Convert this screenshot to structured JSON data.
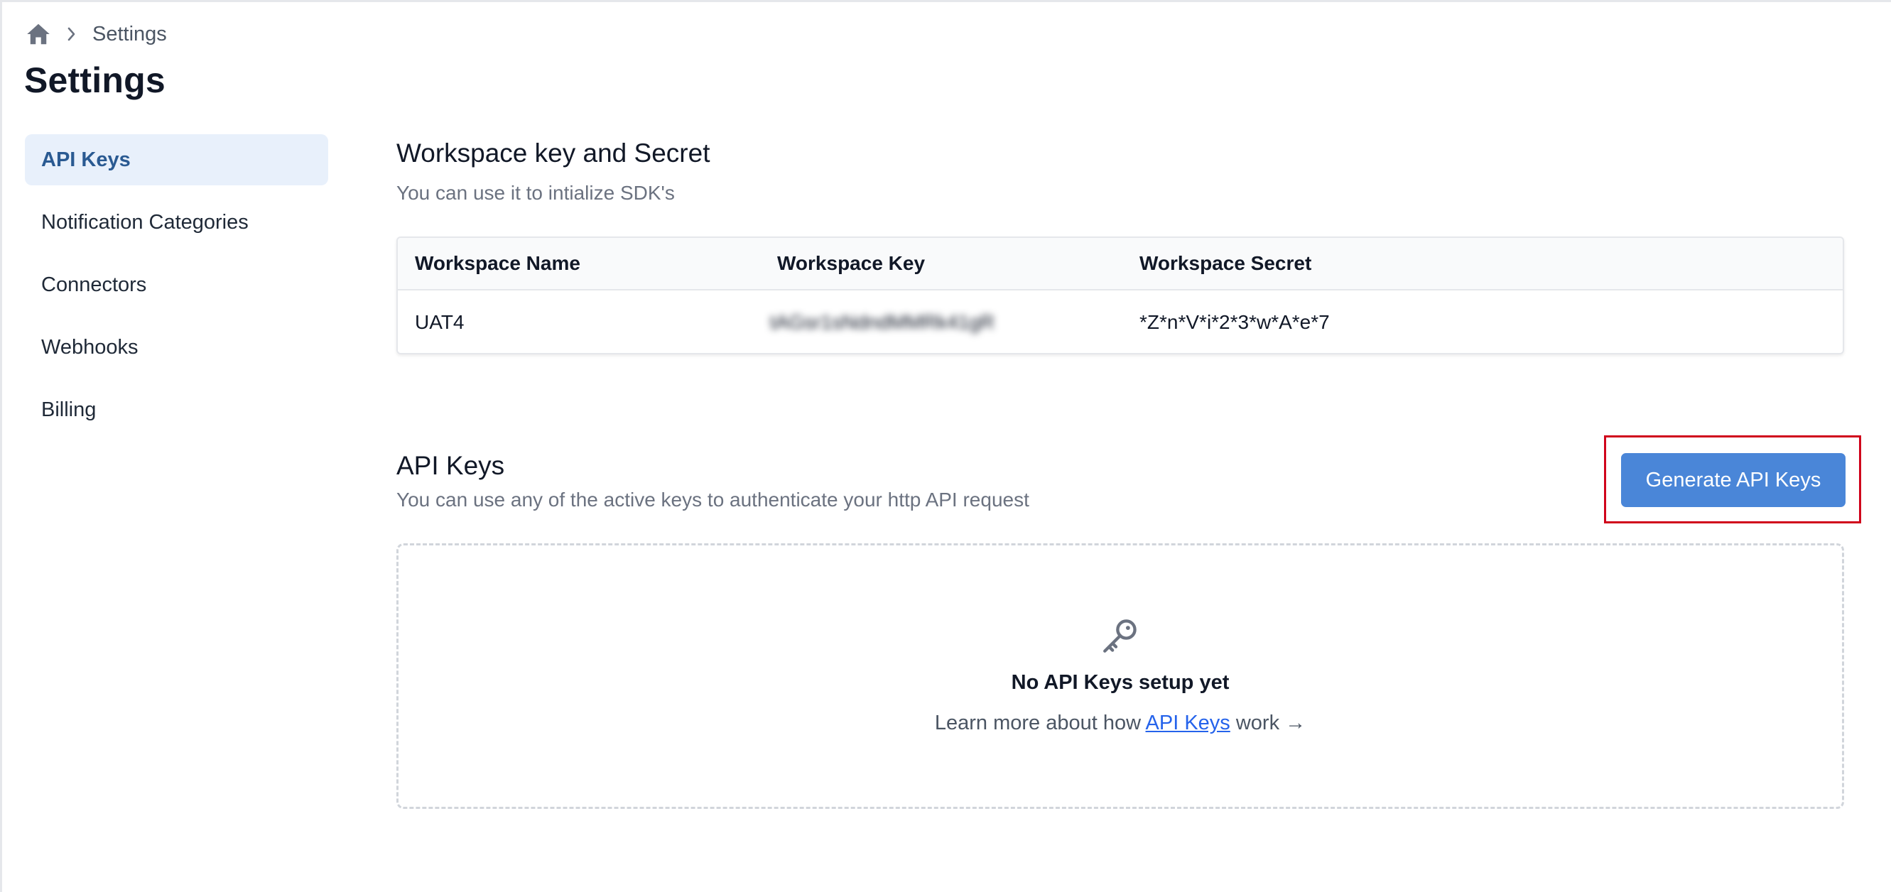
{
  "breadcrumb": {
    "home_icon": "home-icon",
    "separator_icon": "chevron-right-icon",
    "current": "Settings"
  },
  "page_title": "Settings",
  "sidebar": {
    "items": [
      {
        "label": "API Keys",
        "active": true
      },
      {
        "label": "Notification Categories",
        "active": false
      },
      {
        "label": "Connectors",
        "active": false
      },
      {
        "label": "Webhooks",
        "active": false
      },
      {
        "label": "Billing",
        "active": false
      }
    ]
  },
  "workspace": {
    "title": "Workspace key and Secret",
    "subtitle": "You can use it to intialize SDK's",
    "columns": [
      "Workspace Name",
      "Workspace Key",
      "Workspace Secret"
    ],
    "rows": [
      {
        "name": "UAT4",
        "key": "tAGsr1sNdndMMRk41gR",
        "secret": "*Z*n*V*i*2*3*w*A*e*7"
      }
    ]
  },
  "api_keys": {
    "title": "API Keys",
    "subtitle": "You can use any of the active keys to authenticate your http API request",
    "generate_label": "Generate API Keys",
    "empty_icon": "key-icon",
    "empty_title": "No API Keys setup yet",
    "learn_prefix": "Learn more about how ",
    "learn_link": "API Keys",
    "learn_suffix": " work →"
  },
  "colors": {
    "accent": "#4a86d8",
    "highlight_outline": "#d0021b",
    "active_bg": "#e8f0fb",
    "active_text": "#2a5a92",
    "link": "#2563eb"
  }
}
